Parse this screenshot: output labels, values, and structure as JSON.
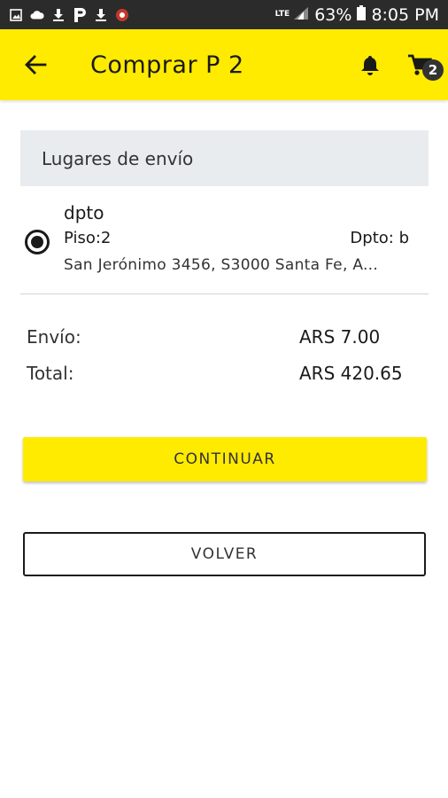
{
  "status_bar": {
    "network": "LTE",
    "battery": "63%",
    "time": "8:05 PM",
    "icons": [
      "image-icon",
      "cloud-icon",
      "download-icon",
      "p-logo-icon",
      "download-icon",
      "app-icon",
      "signal-icon",
      "battery-icon"
    ]
  },
  "header": {
    "title": "Comprar P 2",
    "cart_count": "2",
    "background": "#ffeb00"
  },
  "shipping": {
    "section_title": "Lugares de envío",
    "address": {
      "name": "dpto",
      "floor": "Piso:2",
      "department": "Dpto: b",
      "street": "San Jerónimo 3456, S3000 Santa Fe, A...",
      "selected": true
    }
  },
  "summary": {
    "shipping_label": "Envío:",
    "shipping_value": "ARS 7.00",
    "total_label": "Total:",
    "total_value": "ARS 420.65"
  },
  "actions": {
    "continue_label": "CONTINUAR",
    "back_label": "VOLVER"
  }
}
